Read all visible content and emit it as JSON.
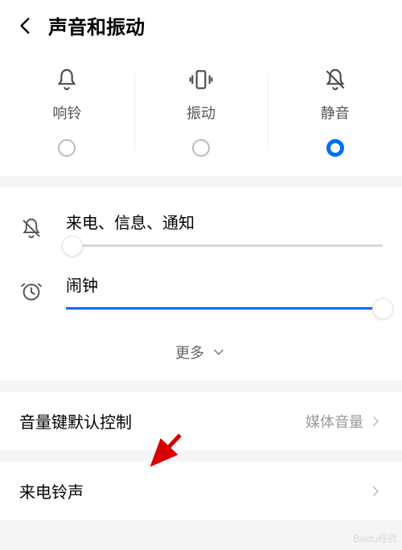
{
  "header": {
    "title": "声音和振动"
  },
  "modes": {
    "items": [
      {
        "label": "响铃",
        "icon": "bell",
        "selected": false
      },
      {
        "label": "振动",
        "icon": "vibrate",
        "selected": false
      },
      {
        "label": "静音",
        "icon": "bell-off",
        "selected": true
      }
    ]
  },
  "sliders": {
    "incoming": {
      "label": "来电、信息、通知",
      "value": 0.02
    },
    "alarm": {
      "label": "闹钟",
      "value": 1.0
    },
    "more_label": "更多"
  },
  "settings": {
    "volume_key": {
      "label": "音量键默认控制",
      "value": "媒体音量"
    },
    "ringtone": {
      "label": "来电铃声",
      "value": ""
    }
  },
  "watermark": "Baidu经验"
}
